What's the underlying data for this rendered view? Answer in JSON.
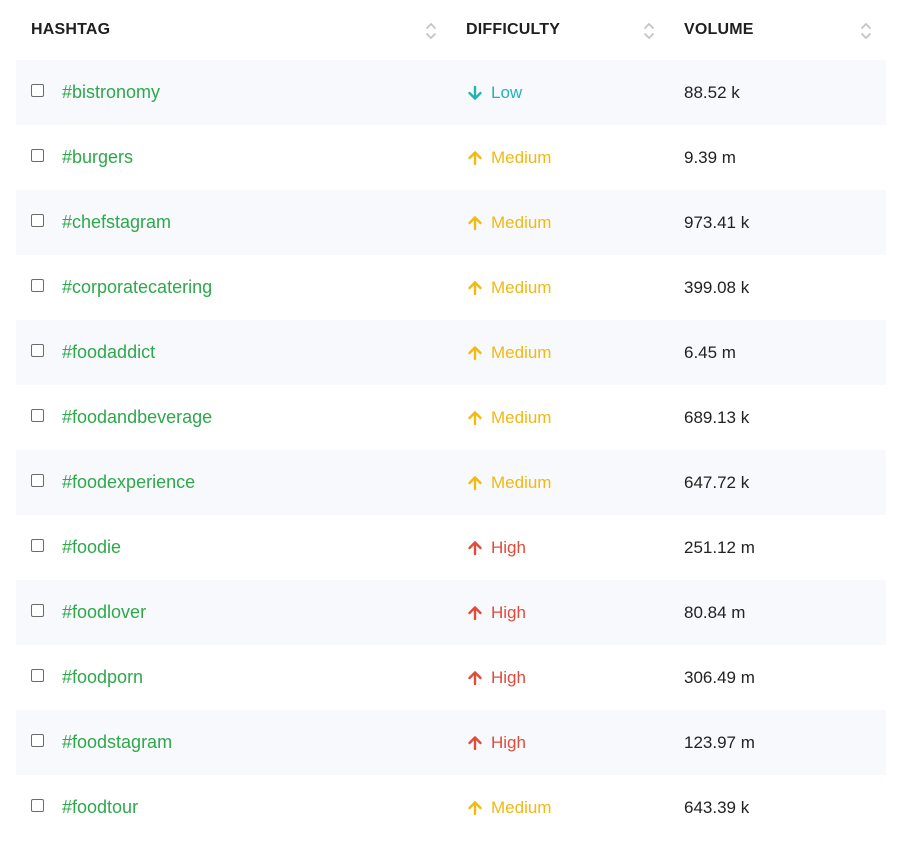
{
  "colors": {
    "hashtag": "#2ea84a",
    "low": "#22b3b3",
    "medium": "#f2b90f",
    "high": "#e04b3a"
  },
  "header": {
    "hashtag": "HASHTAG",
    "difficulty": "DIFFICULTY",
    "volume": "VOLUME",
    "sort_icon": "sort-updown-icon"
  },
  "rows": [
    {
      "hashtag": "#bistronomy",
      "difficulty": "Low",
      "level": "low",
      "icon": "arrow-down-icon",
      "volume": "88.52 k"
    },
    {
      "hashtag": "#burgers",
      "difficulty": "Medium",
      "level": "medium",
      "icon": "arrow-up-icon",
      "volume": "9.39 m"
    },
    {
      "hashtag": "#chefstagram",
      "difficulty": "Medium",
      "level": "medium",
      "icon": "arrow-up-icon",
      "volume": "973.41 k"
    },
    {
      "hashtag": "#corporatecatering",
      "difficulty": "Medium",
      "level": "medium",
      "icon": "arrow-up-icon",
      "volume": "399.08 k"
    },
    {
      "hashtag": "#foodaddict",
      "difficulty": "Medium",
      "level": "medium",
      "icon": "arrow-up-icon",
      "volume": "6.45 m"
    },
    {
      "hashtag": "#foodandbeverage",
      "difficulty": "Medium",
      "level": "medium",
      "icon": "arrow-up-icon",
      "volume": "689.13 k"
    },
    {
      "hashtag": "#foodexperience",
      "difficulty": "Medium",
      "level": "medium",
      "icon": "arrow-up-icon",
      "volume": "647.72 k"
    },
    {
      "hashtag": "#foodie",
      "difficulty": "High",
      "level": "high",
      "icon": "arrow-up-icon",
      "volume": "251.12 m"
    },
    {
      "hashtag": "#foodlover",
      "difficulty": "High",
      "level": "high",
      "icon": "arrow-up-icon",
      "volume": "80.84 m"
    },
    {
      "hashtag": "#foodporn",
      "difficulty": "High",
      "level": "high",
      "icon": "arrow-up-icon",
      "volume": "306.49 m"
    },
    {
      "hashtag": "#foodstagram",
      "difficulty": "High",
      "level": "high",
      "icon": "arrow-up-icon",
      "volume": "123.97 m"
    },
    {
      "hashtag": "#foodtour",
      "difficulty": "Medium",
      "level": "medium",
      "icon": "arrow-up-icon",
      "volume": "643.39 k"
    }
  ]
}
